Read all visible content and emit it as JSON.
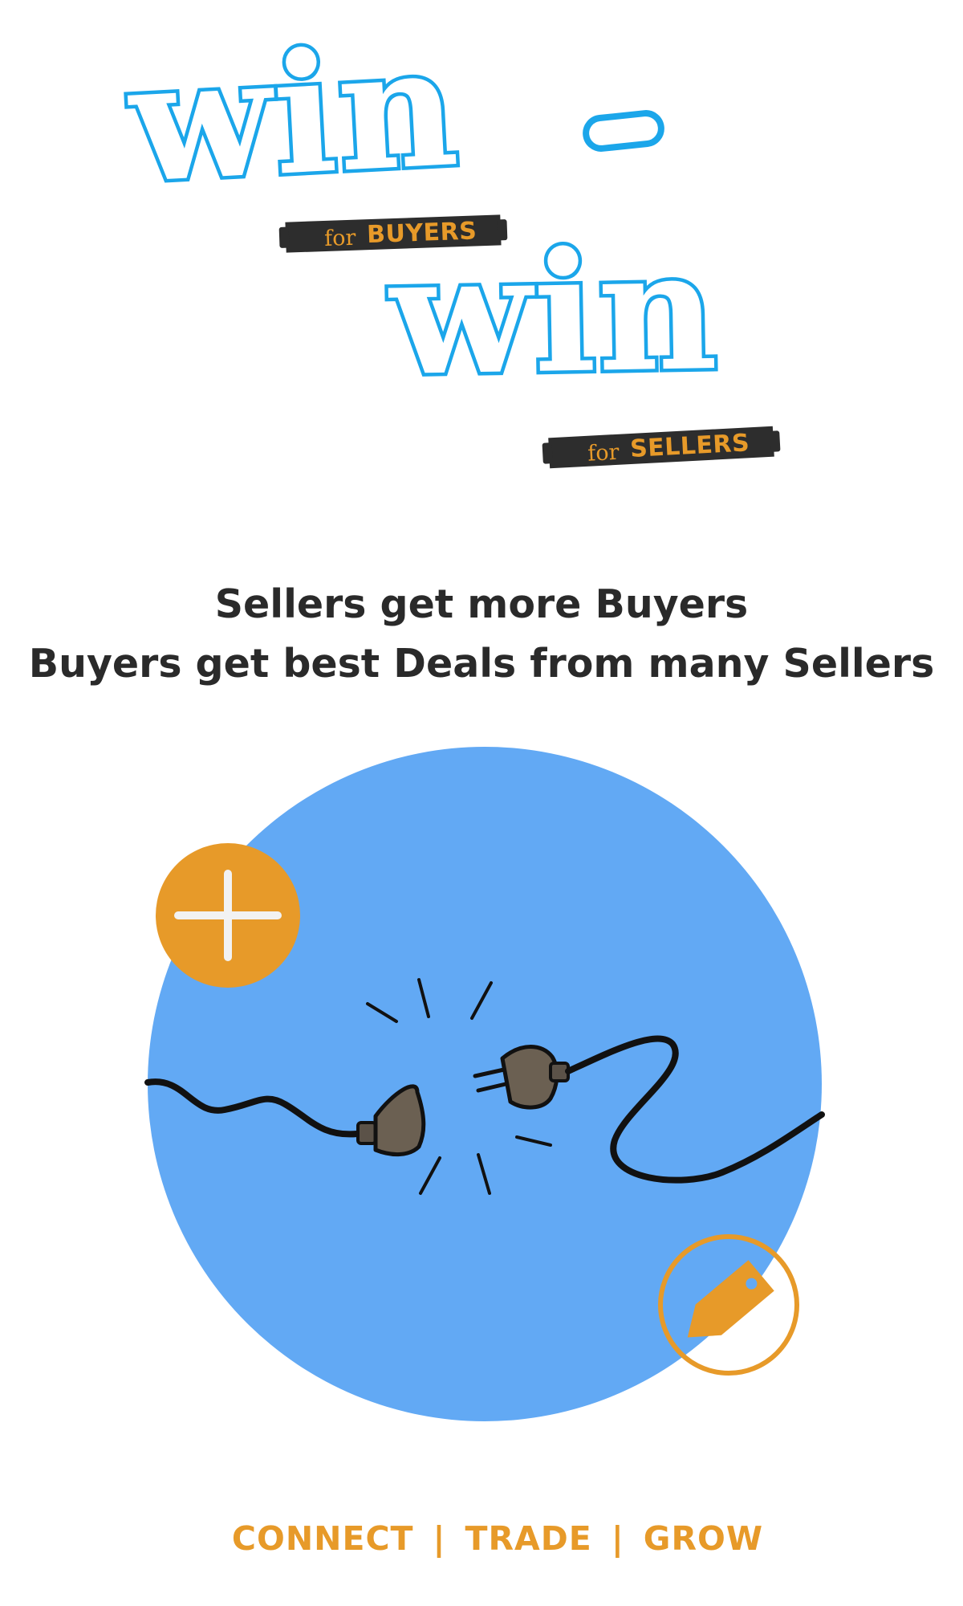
{
  "logo": {
    "word_1": "win",
    "dash": "-",
    "word_2": "win",
    "tag_buyers": {
      "for": "for",
      "role": "BUYERS"
    },
    "tag_sellers": {
      "for": "for",
      "role": "SELLERS"
    }
  },
  "tagline": {
    "line_1": "Sellers get more Buyers",
    "line_2": "Buyers get best Deals from many Sellers"
  },
  "illustration": {
    "circle_color": "#62a9f4",
    "accent_color": "#e79a29",
    "icons": [
      "plus-icon",
      "price-tag-icon",
      "plug-icon",
      "socket-icon"
    ]
  },
  "motto": {
    "items": [
      "CONNECT",
      "TRADE",
      "GROW"
    ],
    "separator": "|"
  },
  "colors": {
    "logo_blue": "#1ba6ea",
    "tag_bg": "#2d2d2d",
    "accent_orange": "#e79a29",
    "text_dark": "#2a2a2a"
  }
}
